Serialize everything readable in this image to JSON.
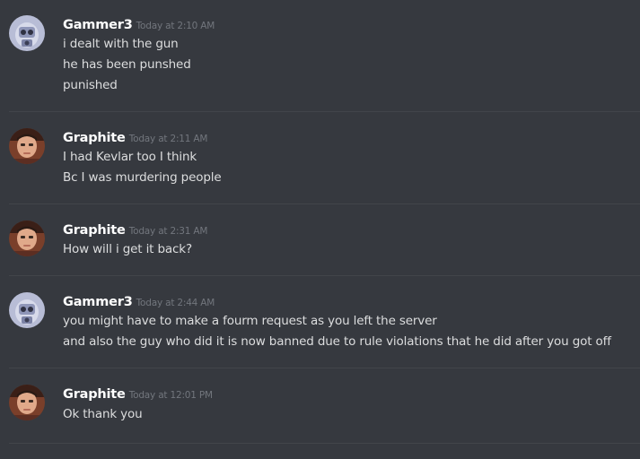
{
  "messages": [
    {
      "author": "Gammer3",
      "timestamp": "Today at 2:10 AM",
      "avatar": "robot-avatar-icon",
      "lines": [
        "i dealt with the gun",
        "he has been punshed",
        "punished"
      ]
    },
    {
      "author": "Graphite",
      "timestamp": "Today at 2:11 AM",
      "avatar": "person-avatar-icon",
      "lines": [
        "I had Kevlar too I think",
        "Bc I was murdering people"
      ]
    },
    {
      "author": "Graphite",
      "timestamp": "Today at 2:31 AM",
      "avatar": "person-avatar-icon",
      "lines": [
        "How will i get it back?"
      ]
    },
    {
      "author": "Gammer3",
      "timestamp": "Today at 2:44 AM",
      "avatar": "robot-avatar-icon",
      "lines": [
        "you might have to make a fourm request as you left the server",
        "and also the guy who did it is now banned due to rule violations that he did after you got off"
      ]
    },
    {
      "author": "Graphite",
      "timestamp": "Today at 12:01 PM",
      "avatar": "person-avatar-icon",
      "lines": [
        "Ok thank you"
      ]
    }
  ],
  "colors": {
    "background": "#36393f",
    "username": "#ffffff",
    "timestamp": "#72767d",
    "text": "#dcddde",
    "divider": "#42454a"
  }
}
